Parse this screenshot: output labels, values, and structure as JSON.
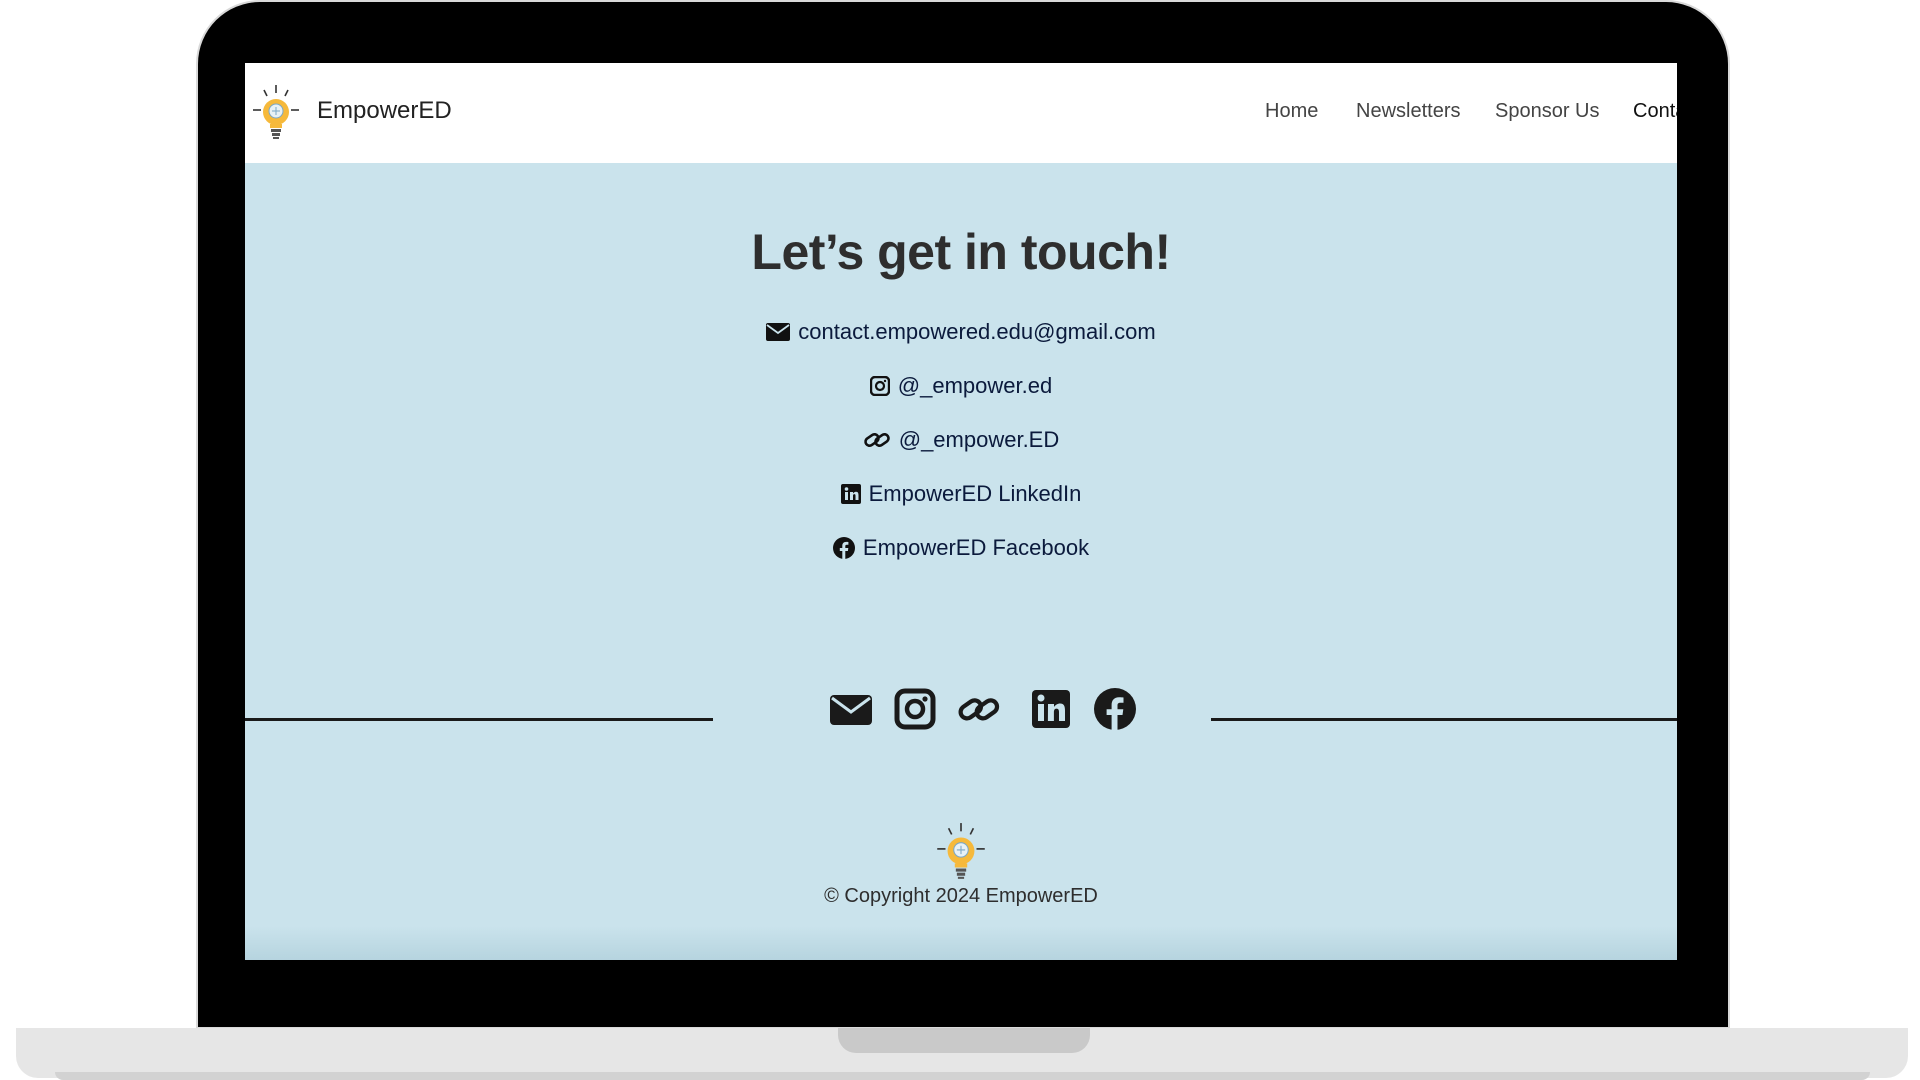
{
  "site": {
    "brand_name": "EmpowerED",
    "nav": [
      {
        "label": "Home"
      },
      {
        "label": "Newsletters"
      },
      {
        "label": "Sponsor Us"
      },
      {
        "label": "Conta"
      }
    ]
  },
  "contact": {
    "heading": "Let’s get in touch!",
    "links": [
      {
        "icon": "envelope-icon",
        "text": "contact.empowered.edu@gmail.com"
      },
      {
        "icon": "instagram-icon",
        "text": "@_empower.ed"
      },
      {
        "icon": "link-icon",
        "text": "@_empower.ED"
      },
      {
        "icon": "linkedin-icon",
        "text": "EmpowerED LinkedIn"
      },
      {
        "icon": "facebook-icon",
        "text": "EmpowerED Facebook"
      }
    ]
  },
  "footer": {
    "social_icons": [
      "envelope-icon",
      "instagram-icon",
      "link-icon",
      "linkedin-icon",
      "facebook-icon"
    ],
    "copyright": "© Copyright 2024 EmpowerED"
  },
  "colors": {
    "page_background": "#cae3ec",
    "link_text": "#0b1a3c",
    "heading_text": "#2e2e2e",
    "bezel": "#000000",
    "bulb_yellow": "#f6b93b"
  }
}
